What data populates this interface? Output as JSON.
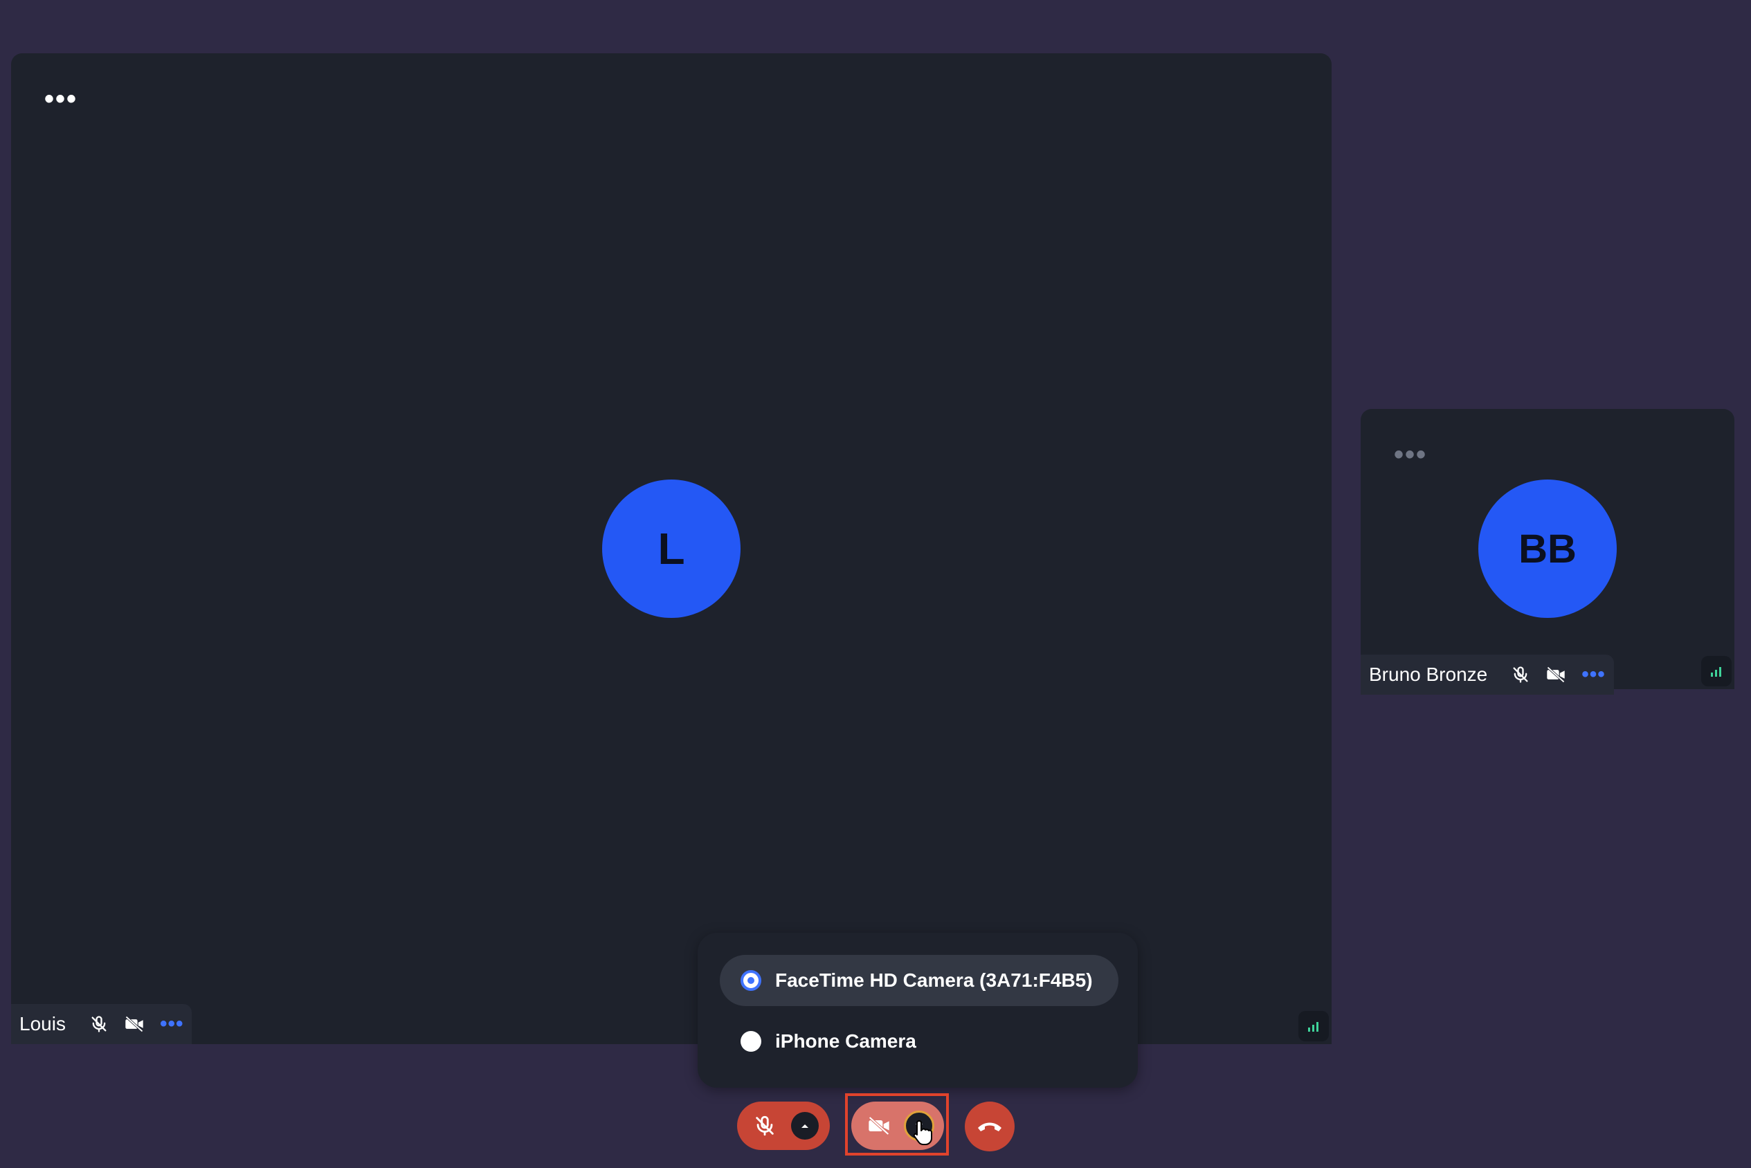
{
  "participants": [
    {
      "name": "Louis",
      "initials": "L",
      "menu": "•••"
    },
    {
      "name": "Bruno Bronze",
      "initials": "BB",
      "menu": "•••"
    }
  ],
  "camera_menu": {
    "options": [
      {
        "label": "FaceTime HD Camera (3A71:F4B5)",
        "selected": true
      },
      {
        "label": "iPhone Camera",
        "selected": false
      }
    ]
  },
  "name_tag_menu": "•••",
  "colors": {
    "background": "#2f2a45",
    "tile": "#1e222c",
    "avatar": "#2458f5",
    "danger": "#c74535",
    "accent": "#3f73ff",
    "highlight": "#e1432c"
  },
  "icons": {
    "mic": "mic-off-icon",
    "camera": "camera-off-icon",
    "hangup": "phone-hangup-icon",
    "signal": "signal-bars-icon"
  }
}
